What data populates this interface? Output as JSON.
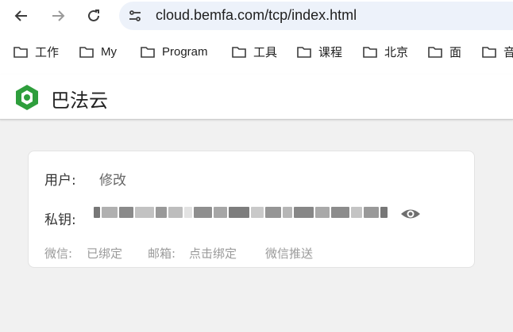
{
  "browser": {
    "url": "cloud.bemfa.com/tcp/index.html",
    "nav_icons": [
      "back-arrow-icon",
      "forward-arrow-icon",
      "reload-icon",
      "site-info-icon"
    ],
    "bookmarks": [
      "工作",
      "My",
      "Program",
      "工具",
      "课程",
      "北京",
      "面",
      "音"
    ]
  },
  "app": {
    "brand_name": "巴法云",
    "brand_color": "#2e9e3c"
  },
  "account_card": {
    "user_label": "用户:",
    "user_value": "修改",
    "key_label": "私钥:",
    "key_masked": true,
    "wechat_label": "微信:",
    "wechat_value": "已绑定",
    "email_label": "邮箱:",
    "email_value": "点击绑定",
    "wechat_push_label": "微信推送"
  }
}
